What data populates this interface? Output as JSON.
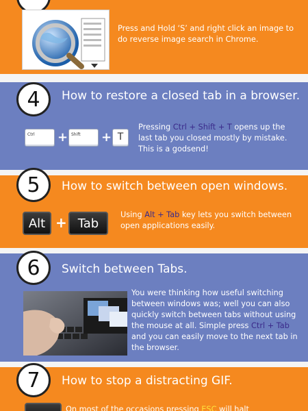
{
  "section3": {
    "text": "Press and Hold ‘S’ and right click an image to do reverse image search in Chrome.",
    "icon": "globe-magnifier-icon"
  },
  "section4": {
    "number": "4",
    "title": "How to restore a closed tab in a browser.",
    "keys": [
      "Ctrl",
      "Shift",
      "T"
    ],
    "plus": "+",
    "text_pre": "Pressing ",
    "text_hl": "Ctrl + Shift + T",
    "text_post": " opens up the last tab you closed mostly by mistake. This is a godsend!"
  },
  "section5": {
    "number": "5",
    "title": "How to switch between open windows.",
    "keys": [
      "Alt",
      "Tab"
    ],
    "plus": "+",
    "text_pre": "Using ",
    "text_hl": "Alt + Tab",
    "text_post": " key lets you switch between open applications easily."
  },
  "section6": {
    "number": "6",
    "title": "Switch between Tabs.",
    "text_pre": "You were thinking how useful switching between windows was; well you can also quickly switch between tabs without using the mouse at all. Simple press ",
    "text_hl": "Ctrl + Tab",
    "text_post": " and you can easily move to the next tab in the browser."
  },
  "section7": {
    "number": "7",
    "title": "How to stop a distracting GIF.",
    "text_pre": "On most of the occasions pressing ",
    "text_hl": "ESC",
    "text_post": " will halt"
  },
  "colors": {
    "orange": "#f5891f",
    "blue": "#6c7fc0",
    "highlight": "#ffe23a"
  }
}
